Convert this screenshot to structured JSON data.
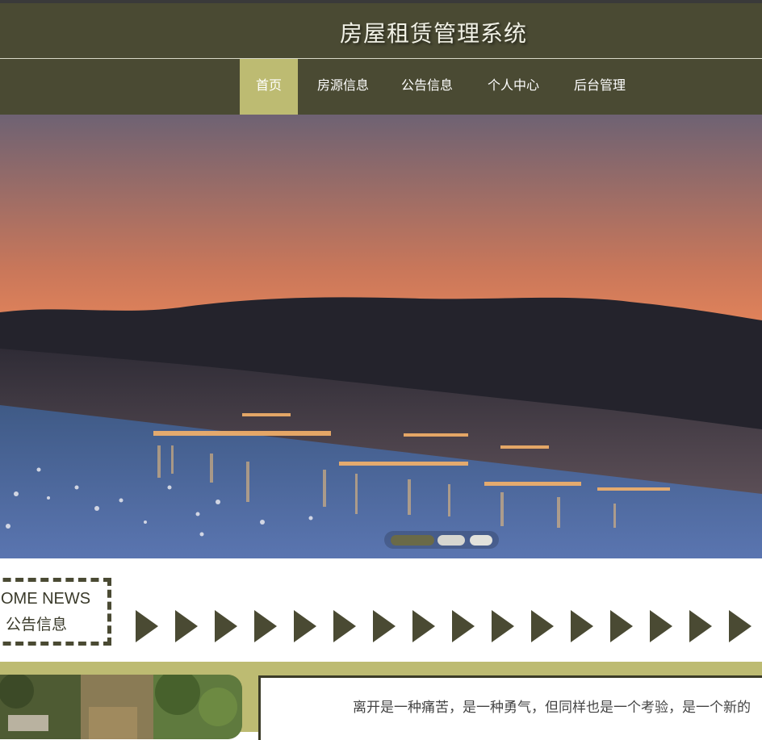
{
  "header": {
    "title": "房屋租赁管理系统"
  },
  "nav": {
    "items": [
      {
        "label": "首页",
        "active": true
      },
      {
        "label": "房源信息",
        "active": false
      },
      {
        "label": "公告信息",
        "active": false
      },
      {
        "label": "个人中心",
        "active": false
      },
      {
        "label": "后台管理",
        "active": false
      }
    ]
  },
  "banner": {
    "slide_count": 3,
    "active_slide": 0
  },
  "news": {
    "title_en": "OME NEWS",
    "title_cn": "公告信息"
  },
  "notice": {
    "text": "离开是一种痛苦，是一种勇气，但同样也是一个考验，是一个新的"
  },
  "colors": {
    "header_bg": "#4a4a33",
    "accent": "#bdbb72",
    "arrow": "#4a4a33"
  }
}
